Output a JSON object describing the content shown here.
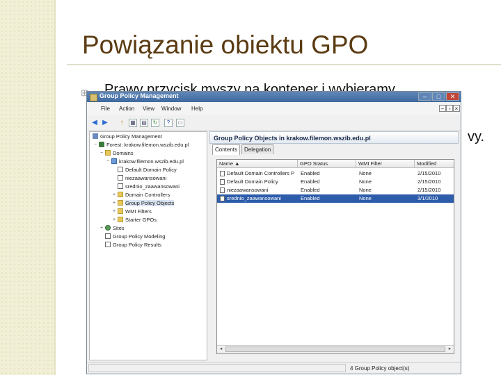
{
  "slide": {
    "title": "Powiązanie obiektu GPO",
    "bullet_visible": "Prawy przycisk myszy na kontener i wybieramy",
    "bullet_tail": "vy."
  },
  "window": {
    "title": "Group Policy Management",
    "controls": {
      "minimize": "–",
      "maximize": "□",
      "close": "✕"
    },
    "menu": [
      "File",
      "Action",
      "View",
      "Window",
      "Help"
    ],
    "menu_controls": {
      "minimize": "–",
      "restore": "▫",
      "close": "×"
    },
    "toolbar": {
      "back": "◀",
      "forward": "▶",
      "up": "↑",
      "tile": "▦",
      "properties": "▤",
      "refresh": "↻",
      "help": "?",
      "view": "▭"
    }
  },
  "tree": [
    {
      "label": "Group Policy Management",
      "icon": "gpm-icon",
      "depth": 0,
      "expander": ""
    },
    {
      "label": "Forest: krakow.filemon.wszib.edu.pl",
      "icon": "forest-icon",
      "depth": 1,
      "expander": "−"
    },
    {
      "label": "Domains",
      "icon": "folder-icon",
      "depth": 2,
      "expander": "−"
    },
    {
      "label": "krakow.filemon.wszib.edu.pl",
      "icon": "domain-icon",
      "depth": 3,
      "expander": "−"
    },
    {
      "label": "Default Domain Policy",
      "icon": "script-icon",
      "depth": 4,
      "expander": ""
    },
    {
      "label": "niezaawansowani",
      "icon": "script-icon",
      "depth": 4,
      "expander": ""
    },
    {
      "label": "srednio_zaawansowani",
      "icon": "script-icon",
      "depth": 4,
      "expander": ""
    },
    {
      "label": "Domain Controllers",
      "icon": "folder-icon",
      "depth": 4,
      "expander": "+"
    },
    {
      "label": "Group Policy Objects",
      "icon": "folder-icon",
      "depth": 4,
      "expander": "+",
      "selected": true
    },
    {
      "label": "WMI Filters",
      "icon": "folder-icon",
      "depth": 4,
      "expander": "+"
    },
    {
      "label": "Starter GPOs",
      "icon": "folder-icon",
      "depth": 4,
      "expander": "+"
    },
    {
      "label": "Sites",
      "icon": "sites-icon",
      "depth": 2,
      "expander": "+"
    },
    {
      "label": "Group Policy Modeling",
      "icon": "script-icon",
      "depth": 2,
      "expander": ""
    },
    {
      "label": "Group Policy Results",
      "icon": "script-icon",
      "depth": 2,
      "expander": ""
    }
  ],
  "right_pane": {
    "header": "Group Policy Objects in krakow.filemon.wszib.edu.pl",
    "tabs": [
      "Contents",
      "Delegation"
    ],
    "columns": [
      "Name  ▲",
      "GPO Status",
      "WMI Filter",
      "Modified"
    ],
    "rows": [
      {
        "name": "Default Domain Controllers P",
        "status": "Enabled",
        "wmi": "None",
        "modified": "2/15/2010"
      },
      {
        "name": "Default Domain Policy",
        "status": "Enabled",
        "wmi": "None",
        "modified": "2/15/2010"
      },
      {
        "name": "niezaawansowani",
        "status": "Enabled",
        "wmi": "None",
        "modified": "2/15/2010"
      },
      {
        "name": "srednio_zaawansowani",
        "status": "Enabled",
        "wmi": "None",
        "modified": "3/1/2010",
        "selected": true
      }
    ]
  },
  "statusbar": {
    "text": "4 Group Policy object(s)"
  },
  "colors": {
    "title": "#5b3b12",
    "titlebar": "#4a76ad",
    "selection": "#2c5caa",
    "left_strip": "#f1efd6"
  }
}
